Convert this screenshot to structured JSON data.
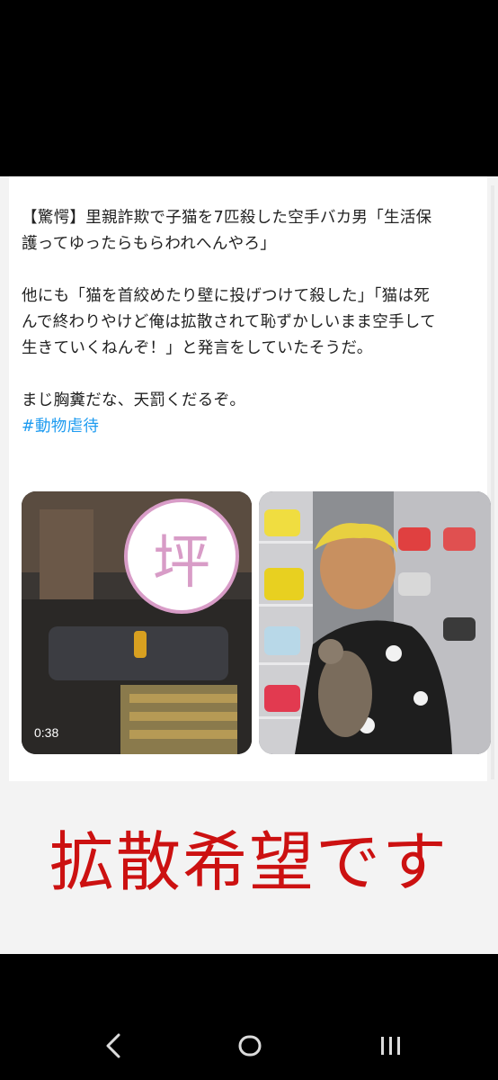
{
  "post": {
    "title_line1": "【驚愕】里親詐欺で子猫を7匹殺した空手バカ男「生活保",
    "title_line2": "護ってゆったらもらわれへんやろ」",
    "body_line1": "他にも「猫を首絞めたり壁に投げつけて殺した」「猫は死",
    "body_line2": "んで終わりやけど俺は拡散されて恥ずかしいまま空手して",
    "body_line3": "生きていくねんぞ！」と発言をしていたそうだ。",
    "comment": "まじ胸糞だな、天罰くだるぞ。",
    "hashtag": "#動物虐待"
  },
  "media": {
    "left": {
      "censor_label": "坪",
      "duration": "0:38"
    },
    "right": {}
  },
  "appeal_text": "拡散希望です",
  "navigation": {
    "back_icon": "chevron-left-icon",
    "home_icon": "circle-home-icon",
    "recents_icon": "recents-bars-icon"
  },
  "colors": {
    "hashtag": "#1d9bf0",
    "appeal": "#cc1111",
    "censor_circle": "#d89cc7"
  }
}
